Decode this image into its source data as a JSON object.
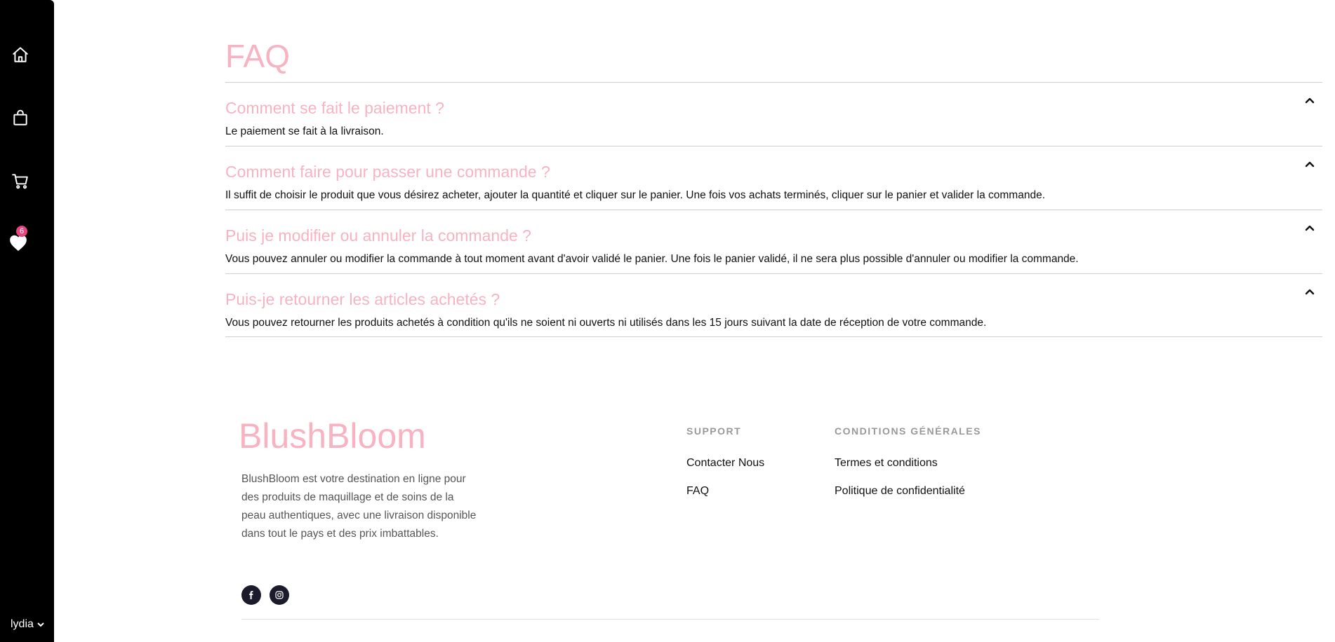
{
  "sidebar": {
    "items": [
      {
        "icon": "home-icon"
      },
      {
        "icon": "shopping-bag-icon"
      },
      {
        "icon": "cart-icon"
      },
      {
        "icon": "heart-icon",
        "badge": "6"
      }
    ],
    "user": "lydia"
  },
  "faq": {
    "title": "FAQ",
    "items": [
      {
        "question": "Comment se fait le paiement ?",
        "answer": "Le paiement se fait à la livraison."
      },
      {
        "question": "Comment faire pour passer une commande ?",
        "answer": "Il suffit de choisir le produit que vous désirez acheter, ajouter la quantité et cliquer sur le panier. Une fois vos achats terminés, cliquer sur le panier et valider la commande."
      },
      {
        "question": "Puis je modifier ou annuler la commande ?",
        "answer": "Vous pouvez annuler ou modifier la commande à tout moment avant d'avoir validé le panier. Une fois le panier validé, il ne sera plus possible d'annuler ou modifier la commande."
      },
      {
        "question": "Puis-je retourner les articles achetés ?",
        "answer": "Vous pouvez retourner les produits achetés à condition qu'ils ne soient ni ouverts ni utilisés dans les 15 jours suivant la date de réception de votre commande."
      }
    ]
  },
  "footer": {
    "brand": "BlushBloom",
    "description": "BlushBloom est votre destination en ligne pour des produits de maquillage et de soins de la peau authentiques, avec une livraison disponible dans tout le pays et des prix imbattables.",
    "social": [
      "facebook-icon",
      "instagram-icon"
    ],
    "support": {
      "heading": "SUPPORT",
      "links": [
        "Contacter Nous",
        "FAQ"
      ]
    },
    "conditions": {
      "heading": "CONDITIONS GÉNÉRALES",
      "links": [
        "Termes et conditions",
        "Politique de confidentialité"
      ]
    }
  },
  "colors": {
    "accent_pink": "#f7b3c2",
    "badge_pink": "#e8457f",
    "sidebar_bg": "#000000"
  }
}
